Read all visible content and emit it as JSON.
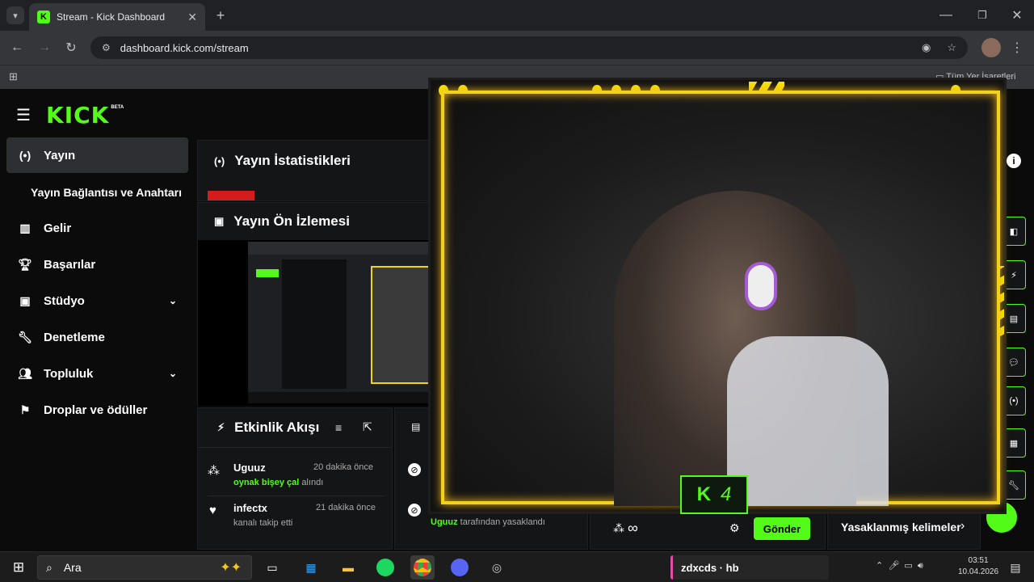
{
  "browser": {
    "tab_title": "Stream - Kick Dashboard",
    "url": "dashboard.kick.com/stream",
    "bookmarks_label": "Tüm Yer İşaretleri"
  },
  "kick": {
    "logo": "KICK",
    "logo_badge": "BETA",
    "brand_color": "#53fc18",
    "nav": [
      {
        "label": "Yayın",
        "icon": "broadcast-icon"
      },
      {
        "label": "Yayın Bağlantısı ve Anahtarı",
        "icon": ""
      },
      {
        "label": "Gelir",
        "icon": "chart-icon"
      },
      {
        "label": "Başarılar",
        "icon": "trophy-icon"
      },
      {
        "label": "Stüdyo",
        "icon": "studio-icon"
      },
      {
        "label": "Denetleme",
        "icon": "wrench-icon"
      },
      {
        "label": "Topluluk",
        "icon": "people-icon"
      },
      {
        "label": "Droplar ve ödüller",
        "icon": "drops-icon"
      }
    ],
    "stats_title": "Yayın İstatistikleri",
    "preview_title": "Yayın Ön İzlemesi",
    "activity": {
      "title": "Etkinlik Akışı",
      "items": [
        {
          "user": "Uguuz",
          "time": "20 dakika önce",
          "highlight": "oynak bişey çal",
          "action": "alındı"
        },
        {
          "user": "infectx",
          "time": "21 dakika önce",
          "highlight": "",
          "action": "kanalı takip etti"
        }
      ]
    },
    "moderation": {
      "user": "Uguuz",
      "text": "tarafından yasaklandı"
    },
    "chat": {
      "infinity": "∞",
      "send_label": "Gönder"
    },
    "banned_words_label": "Yasaklanmış kelimeler"
  },
  "overlay": {
    "badge_letter": "K",
    "badge_number": "4",
    "frame_color": "#f2d21b"
  },
  "taskbar": {
    "search_label": "Ara",
    "now_playing": "zdxcds · hb",
    "time": "03:51",
    "date": "10.04.2026"
  }
}
